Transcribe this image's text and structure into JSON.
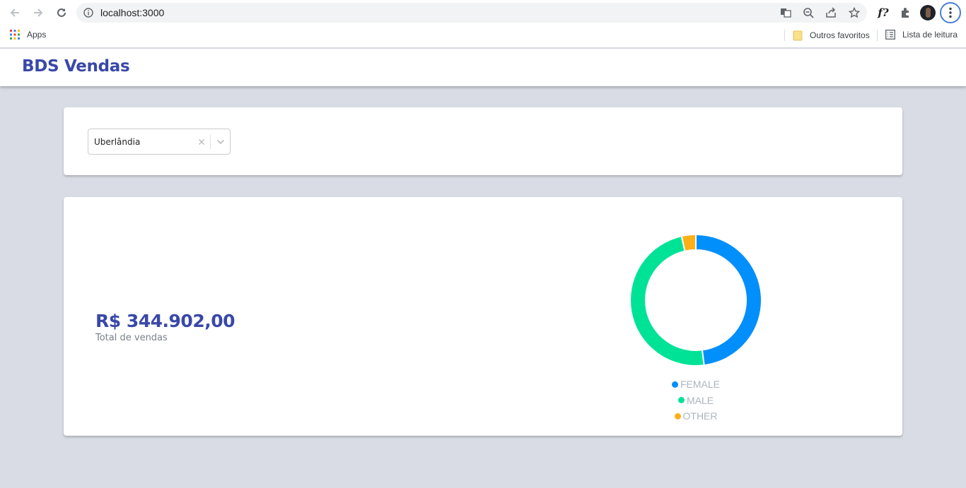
{
  "browser": {
    "url": "localhost:3000",
    "bookmarks": {
      "apps_label": "Apps",
      "others_label": "Outros favoritos",
      "reading_list_label": "Lista de leitura"
    },
    "extension_label": "f?"
  },
  "app": {
    "title": "BDS Vendas"
  },
  "filter": {
    "selected_store": "Uberlândia"
  },
  "summary": {
    "total_value": "R$ 344.902,00",
    "total_label": "Total de vendas"
  },
  "chart_data": {
    "type": "pie",
    "series": [
      {
        "name": "FEMALE",
        "value": 48,
        "color": "#008ffb"
      },
      {
        "name": "MALE",
        "value": 48.5,
        "color": "#00e396"
      },
      {
        "name": "OTHER",
        "value": 3.5,
        "color": "#feb019"
      }
    ],
    "legend_position": "bottom"
  },
  "colors": {
    "accent": "#3948a8",
    "background": "#d9dce4"
  }
}
